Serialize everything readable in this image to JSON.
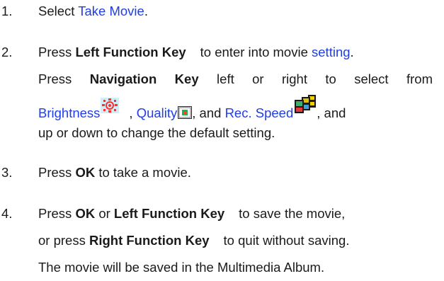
{
  "steps": [
    {
      "number": "1.",
      "pre": "Select ",
      "link": "Take Movie",
      "post": "."
    },
    {
      "number": "2.",
      "line1_a": "Press ",
      "line1_bold": "Left Function Key",
      "line1_b": "to enter into movie ",
      "line1_link": "setting",
      "line1_end": ".",
      "line2_a": "Press ",
      "line2_bold": "Navigation Key",
      "line2_b": "left or right to select from",
      "line3_link1": "Brightness",
      "line3_sep1": ", ",
      "line3_link2": "Quality",
      "line3_sep2": ", and ",
      "line3_link3": "Rec. Speed",
      "line3_end": ", and",
      "line4": "up or down to change the default setting."
    },
    {
      "number": "3.",
      "pre": "Press ",
      "bold": "OK",
      "post": "to take a movie."
    },
    {
      "number": "4.",
      "line1_a": "Press ",
      "line1_bold1": "OK",
      "line1_mid": " or ",
      "line1_bold2": "Left Function Key",
      "line1_b": "to save the movie,",
      "line2_a": "or press ",
      "line2_bold": "Right Function Key",
      "line2_b": "to quit without saving.",
      "line3": "The movie will be saved in the Multimedia Album."
    }
  ],
  "icons": {
    "brightness": "brightness-icon",
    "quality": "quality-icon",
    "rec_speed": "rec-speed-icon"
  }
}
